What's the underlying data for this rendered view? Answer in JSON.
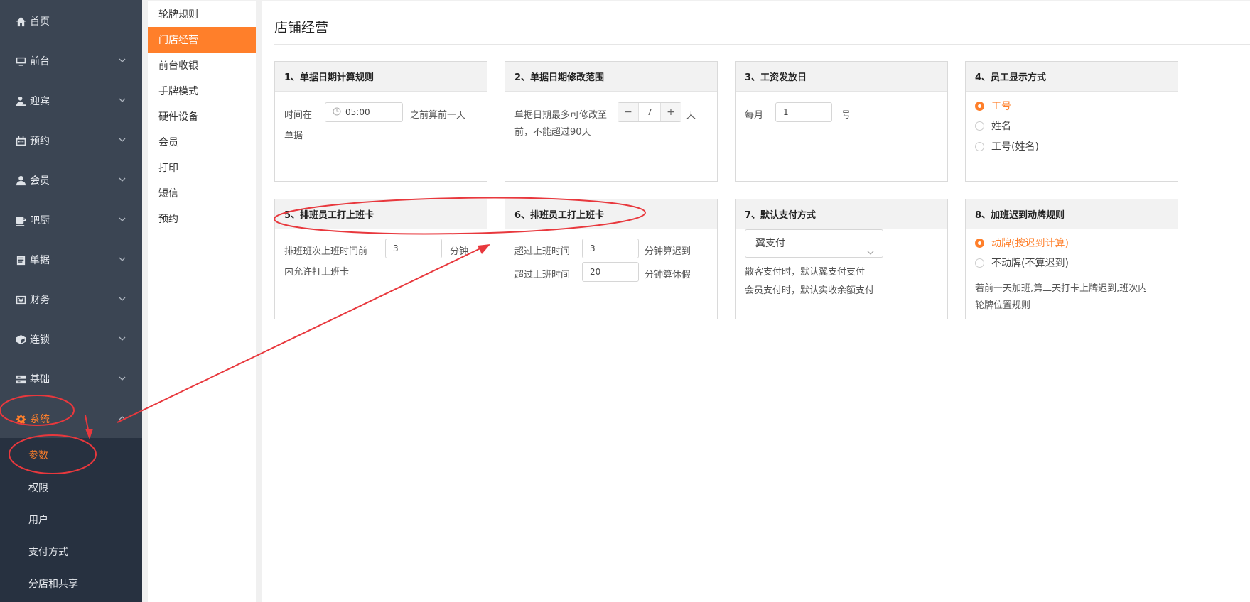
{
  "sidebar": {
    "items": [
      {
        "label": "首页",
        "icon": "home-icon"
      },
      {
        "label": "前台",
        "icon": "monitor-icon"
      },
      {
        "label": "迎宾",
        "icon": "greeter-icon"
      },
      {
        "label": "预约",
        "icon": "calendar-icon"
      },
      {
        "label": "会员",
        "icon": "user-icon"
      },
      {
        "label": "吧厨",
        "icon": "coffee-icon"
      },
      {
        "label": "单据",
        "icon": "document-icon"
      },
      {
        "label": "财务",
        "icon": "finance-icon"
      },
      {
        "label": "连锁",
        "icon": "cube-icon"
      },
      {
        "label": "基础",
        "icon": "database-icon"
      },
      {
        "label": "系统",
        "icon": "gear-icon"
      }
    ],
    "submenu": [
      "参数",
      "权限",
      "用户",
      "支付方式",
      "分店和共享"
    ]
  },
  "secondary_nav": {
    "items": [
      "轮牌规则",
      "门店经营",
      "前台收银",
      "手牌模式",
      "硬件设备",
      "会员",
      "打印",
      "短信",
      "预约"
    ]
  },
  "main": {
    "title": "店铺经营",
    "cards": {
      "c1": {
        "title": "1、单据日期计算规则",
        "prefix": "时间在",
        "time_value": "05:00",
        "suffix": "之前算前一天",
        "suffix2": "单据"
      },
      "c2": {
        "title": "2、单据日期修改范围",
        "prefix": "单据日期最多可修改至",
        "stepper_value": "7",
        "minus": "−",
        "plus": "+",
        "unit": "天",
        "line2": "前，不能超过90天"
      },
      "c3": {
        "title": "3、工资发放日",
        "prefix": "每月",
        "day_value": "1",
        "suffix": "号"
      },
      "c4": {
        "title": "4、员工显示方式",
        "options": [
          "工号",
          "姓名",
          "工号(姓名)"
        ]
      },
      "c5": {
        "title": "5、排班员工打上班卡",
        "prefix": "排班班次上班时间前",
        "value": "3",
        "suffix": "分钟",
        "line2": "内允许打上班卡"
      },
      "c6": {
        "title": "6、排班员工打上班卡",
        "row1_prefix": "超过上班时间",
        "row1_value": "3",
        "row1_suffix": "分钟算迟到",
        "row2_prefix": "超过上班时间",
        "row2_value": "20",
        "row2_suffix": "分钟算休假"
      },
      "c7": {
        "title": "7、默认支付方式",
        "select_value": "翼支付",
        "line1": "散客支付时，默认翼支付支付",
        "line2": "会员支付时，默认实收余额支付"
      },
      "c8": {
        "title": "8、加班迟到动牌规则",
        "options": [
          "动牌(按迟到计算)",
          "不动牌(不算迟到)"
        ],
        "note1": "若前一天加班,第二天打卡上牌迟到,班次内",
        "note2": "轮牌位置规则"
      }
    }
  },
  "colors": {
    "accent": "#ff7f2a",
    "sidebar_bg": "#3b4553",
    "submenu_bg": "#273140",
    "annotation": "#e8383d"
  }
}
